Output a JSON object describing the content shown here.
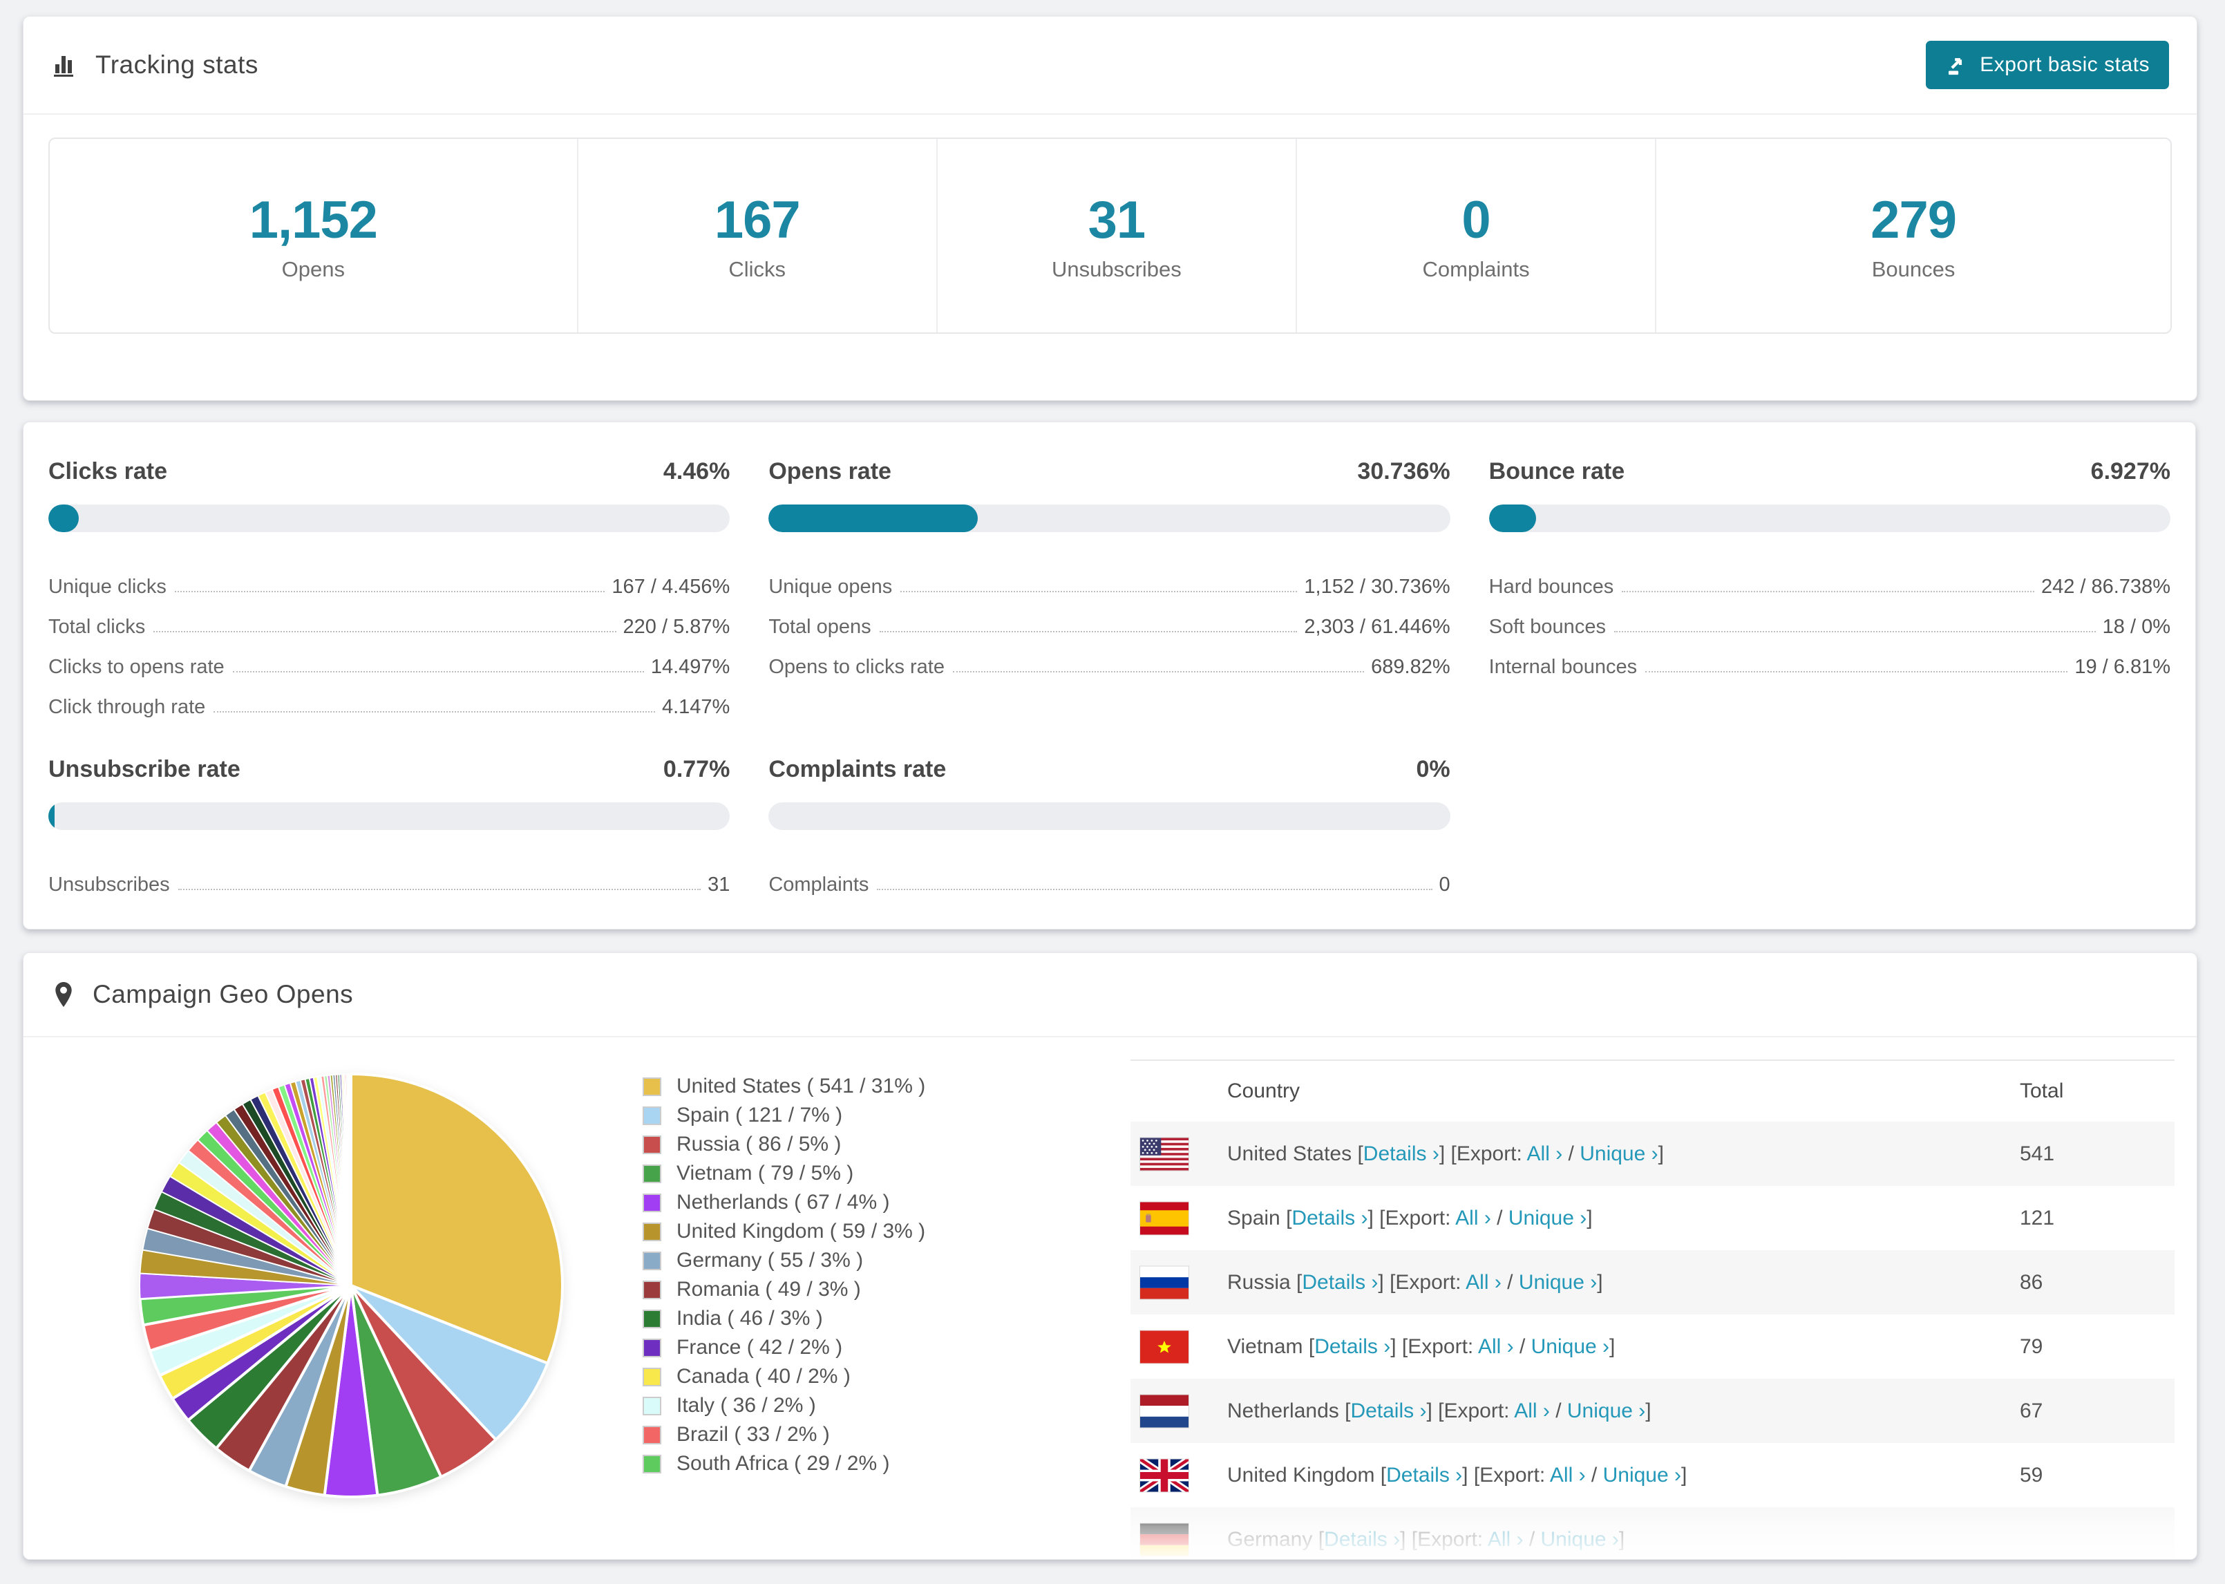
{
  "colors": {
    "accent": "#0d7e94",
    "number_teal": "#1b87a2",
    "link_teal": "#2498b8",
    "bar_fill": "#0f84a0",
    "bar_track": "#ecedf0",
    "page_bg": "#f1f2f4"
  },
  "header": {
    "title": "Tracking stats",
    "export_button": "Export basic stats"
  },
  "summary": [
    {
      "value": "1,152",
      "label": "Opens"
    },
    {
      "value": "167",
      "label": "Clicks"
    },
    {
      "value": "31",
      "label": "Unsubscribes"
    },
    {
      "value": "0",
      "label": "Complaints"
    },
    {
      "value": "279",
      "label": "Bounces"
    }
  ],
  "rates": [
    {
      "title": "Clicks rate",
      "value": "4.46%",
      "fill_pct": 4.46,
      "rows": [
        [
          "Unique clicks",
          "167 / 4.456%"
        ],
        [
          "Total clicks",
          "220 / 5.87%"
        ],
        [
          "Clicks to opens rate",
          "14.497%"
        ],
        [
          "Click through rate",
          "4.147%"
        ]
      ]
    },
    {
      "title": "Opens rate",
      "value": "30.736%",
      "fill_pct": 30.736,
      "rows": [
        [
          "Unique opens",
          "1,152 / 30.736%"
        ],
        [
          "Total opens",
          "2,303 / 61.446%"
        ],
        [
          "Opens to clicks rate",
          "689.82%"
        ]
      ]
    },
    {
      "title": "Bounce rate",
      "value": "6.927%",
      "fill_pct": 6.927,
      "rows": [
        [
          "Hard bounces",
          "242 / 86.738%"
        ],
        [
          "Soft bounces",
          "18 / 0%"
        ],
        [
          "Internal bounces",
          "19 / 6.81%"
        ]
      ]
    },
    {
      "title": "Unsubscribe rate",
      "value": "0.77%",
      "fill_pct": 0.77,
      "rows": [
        [
          "Unsubscribes",
          "31"
        ]
      ]
    },
    {
      "title": "Complaints rate",
      "value": "0%",
      "fill_pct": 0,
      "rows": [
        [
          "Complaints",
          "0"
        ]
      ]
    }
  ],
  "geo": {
    "title": "Campaign Geo Opens",
    "chart_data": {
      "type": "pie",
      "title": "Campaign Geo Opens",
      "start_angle_deg": -90,
      "direction": "clockwise",
      "series": [
        {
          "name": "United States",
          "value": 541,
          "pct": 31,
          "color": "#e6c04a"
        },
        {
          "name": "Spain",
          "value": 121,
          "pct": 7,
          "color": "#a9d5f2"
        },
        {
          "name": "Russia",
          "value": 86,
          "pct": 5,
          "color": "#c84d4d"
        },
        {
          "name": "Vietnam",
          "value": 79,
          "pct": 5,
          "color": "#47a349"
        },
        {
          "name": "Netherlands",
          "value": 67,
          "pct": 4,
          "color": "#a13df2"
        },
        {
          "name": "United Kingdom",
          "value": 59,
          "pct": 3,
          "color": "#b7952c"
        },
        {
          "name": "Germany",
          "value": 55,
          "pct": 3,
          "color": "#8aabc7"
        },
        {
          "name": "Romania",
          "value": 49,
          "pct": 3,
          "color": "#9b3b3b"
        },
        {
          "name": "India",
          "value": 46,
          "pct": 3,
          "color": "#2d7c34"
        },
        {
          "name": "France",
          "value": 42,
          "pct": 2,
          "color": "#6e2ebf"
        },
        {
          "name": "Canada",
          "value": 40,
          "pct": 2,
          "color": "#f8e84b"
        },
        {
          "name": "Italy",
          "value": 36,
          "pct": 2,
          "color": "#d9fbfa"
        },
        {
          "name": "Brazil",
          "value": 33,
          "pct": 2,
          "color": "#f26666"
        },
        {
          "name": "South Africa",
          "value": 29,
          "pct": 2,
          "color": "#5ecb5e"
        }
      ],
      "others": {
        "total_pct": 26,
        "slice_count": 42,
        "decay": 0.93,
        "colors": [
          "#ab5cf0",
          "#b8962e",
          "#7e99b4",
          "#8e3a3a",
          "#2a6e31",
          "#5b2da8",
          "#f3ef4c",
          "#dff9f9",
          "#f56c6c",
          "#63d963",
          "#e256e2",
          "#8f8f22",
          "#557083",
          "#742222",
          "#1c4a24",
          "#2d2d74",
          "#fbf25a",
          "#ffe9e9",
          "#ff5050",
          "#83f383",
          "#c44df5",
          "#caa22b",
          "#a6cfe9",
          "#b05050",
          "#3f9c3f",
          "#7a3bd1",
          "#ffff7a",
          "#e8ffff",
          "#ff9a9a",
          "#a8f0a8",
          "#d98ad9",
          "#a3a32e",
          "#6f8ea3",
          "#8e4a4a",
          "#3a7d42",
          "#4a3a9e",
          "#f7f7a0",
          "#ffd6d6",
          "#ff7b7b",
          "#9cff9c",
          "#d9a6f5",
          "#d7b84a"
        ]
      }
    },
    "legend": [
      {
        "label": "United States ( 541 / 31% )",
        "color": "#e6c04a"
      },
      {
        "label": "Spain ( 121 / 7% )",
        "color": "#a9d5f2"
      },
      {
        "label": "Russia ( 86 / 5% )",
        "color": "#c84d4d"
      },
      {
        "label": "Vietnam ( 79 / 5% )",
        "color": "#47a349"
      },
      {
        "label": "Netherlands ( 67 / 4% )",
        "color": "#a13df2"
      },
      {
        "label": "United Kingdom ( 59 / 3% )",
        "color": "#b7952c"
      },
      {
        "label": "Germany ( 55 / 3% )",
        "color": "#8aabc7"
      },
      {
        "label": "Romania ( 49 / 3% )",
        "color": "#9b3b3b"
      },
      {
        "label": "India ( 46 / 3% )",
        "color": "#2d7c34"
      },
      {
        "label": "France ( 42 / 2% )",
        "color": "#6e2ebf"
      },
      {
        "label": "Canada ( 40 / 2% )",
        "color": "#f8e84b"
      },
      {
        "label": "Italy ( 36 / 2% )",
        "color": "#d9fbfa"
      },
      {
        "label": "Brazil ( 33 / 2% )",
        "color": "#f26666"
      },
      {
        "label": "South Africa ( 29 / 2% )",
        "color": "#5ecb5e"
      }
    ],
    "table": {
      "headers": [
        "Country",
        "Total"
      ],
      "links": {
        "open_bracket": "[",
        "close_bracket": "]",
        "details": "Details ›",
        "export_prefix": "Export:",
        "all": "All ›",
        "slash": "/",
        "unique": "Unique ›"
      },
      "rows": [
        {
          "country": "United States",
          "flag": "us",
          "total": "541"
        },
        {
          "country": "Spain",
          "flag": "es",
          "total": "121"
        },
        {
          "country": "Russia",
          "flag": "ru",
          "total": "86"
        },
        {
          "country": "Vietnam",
          "flag": "vn",
          "total": "79"
        },
        {
          "country": "Netherlands",
          "flag": "nl",
          "total": "67"
        },
        {
          "country": "United Kingdom",
          "flag": "gb",
          "total": "59"
        },
        {
          "country": "Germany",
          "flag": "de",
          "total": ""
        }
      ]
    }
  }
}
